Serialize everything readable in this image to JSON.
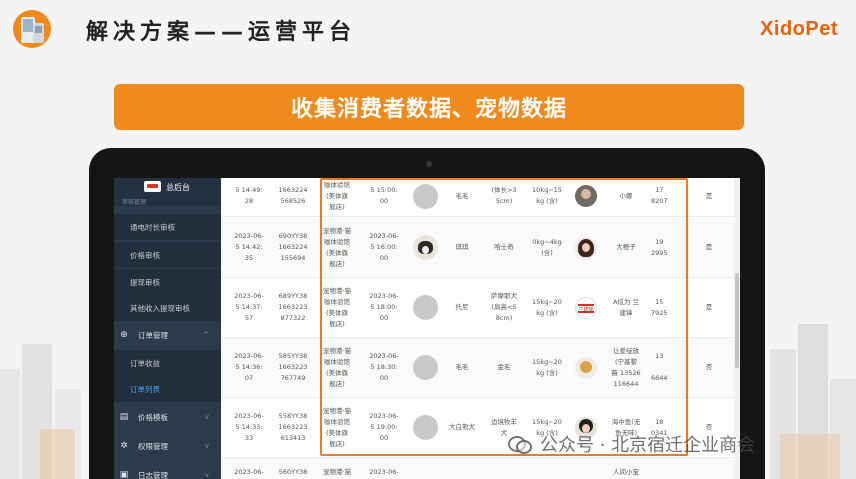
{
  "slide": {
    "title": "解决方案——运营平台",
    "banner": "收集消费者数据、宠物数据",
    "brand": "XidoPet"
  },
  "sidebar": {
    "brand_title": "总后台",
    "cut_label": "审核管理",
    "items": [
      {
        "label": "通电时长审核",
        "style": "sub"
      },
      {
        "label": "价格审核",
        "style": "sub"
      },
      {
        "label": "提现审核",
        "style": "sub"
      },
      {
        "label": "其他收入提现审核",
        "style": "sub"
      },
      {
        "label": "订单管理",
        "style": "group",
        "icon": "⊕",
        "chevron": "^"
      },
      {
        "label": "订单收益",
        "style": "sub"
      },
      {
        "label": "订单列表",
        "style": "sub-active"
      },
      {
        "label": "价格模板",
        "style": "group",
        "icon": "▤",
        "chevron": "v"
      },
      {
        "label": "权限管理",
        "style": "group",
        "icon": "✲",
        "chevron": "v"
      },
      {
        "label": "日志管理",
        "style": "group",
        "icon": "▣",
        "chevron": "v"
      }
    ]
  },
  "table": {
    "rows": [
      {
        "time1": "5 14:49:\n28",
        "order": "1663224\n568526",
        "shop": "咖体验馆\n(美体旗\n舰店)",
        "time2": "5 15:00:\n00",
        "pet_image": "gray",
        "pet_name": "毛毛",
        "breed": "(体长>3\n5cm)",
        "weight": "10kg~15\nkg (含)",
        "avatar": "av-a",
        "owner": "小娜",
        "phone": "17\n8207",
        "flag": "是"
      },
      {
        "time1": "2023-06-\n5 14:42:\n35",
        "order": "690YY38\n1663224\n155694",
        "shop": "宠物港·猫\n咖体验馆\n(美体旗\n舰店)",
        "time2": "2023-06-\n5 16:00:\n00",
        "pet_image": "photo",
        "pet_name": "琪琪",
        "breed": "哈士奇",
        "weight": "0kg~4kg\n(含)",
        "avatar": "av-b",
        "owner": "大橙子",
        "phone": "19\n2995",
        "flag": "是"
      },
      {
        "time1": "2023-06-\n5 14:37:\n57",
        "order": "689YY38\n1663223\n877322",
        "shop": "宠物港·猫\n咖体验馆\n(美体旗\n舰店)",
        "time2": "2023-06-\n5 18:00:\n00",
        "pet_image": "gray",
        "pet_name": "托尼",
        "breed": "萨摩耶犬\n(肩高<5\n8cm)",
        "weight": "15kg~20\nkg (含)",
        "avatar": "av-c",
        "avatar_text": "兰建锋",
        "owner": "A炫为 兰\n建锋",
        "phone": "15\n7925",
        "flag": "是"
      },
      {
        "time1": "2023-06-\n5 14:36:\n07",
        "order": "585YY38\n1663223\n767749",
        "shop": "宠物港·猫\n咖体验馆\n(美体旗\n舰店)",
        "time2": "2023-06-\n5 18:30:\n00",
        "pet_image": "gray",
        "pet_name": "毛毛",
        "breed": "金毛",
        "weight": "15kg~20\nkg (含)",
        "avatar": "av-d",
        "owner": "让爱绽放\n(宁基黎\n薇 13526\n116644",
        "phone": "13\n\n6644",
        "flag": "否"
      },
      {
        "time1": "2023-06-\n5 14:33:\n33",
        "order": "558YY38\n1663223\n613413",
        "shop": "宠物港·猫\n咖体验馆\n(美体旗\n舰店)",
        "time2": "2023-06-\n5 19:00:\n00",
        "pet_image": "gray",
        "pet_name": "大白熊犬",
        "breed": "边境牧羊\n犬",
        "weight": "15kg~20\nkg (含)",
        "avatar": "av-e",
        "owner": "海中鱼(无\n鱼无味)",
        "phone": "18\n0341",
        "flag": "否"
      },
      {
        "time1": "2023-06-",
        "order": "560YY38",
        "shop": "宠物港·猫",
        "time2": "2023-06-",
        "pet_image": "none",
        "pet_name": "",
        "breed": "",
        "weight": "",
        "avatar": "none",
        "owner": "人间小宝",
        "phone": "",
        "flag": ""
      }
    ]
  },
  "watermark": "公众号 · 北京宿迁企业商会"
}
